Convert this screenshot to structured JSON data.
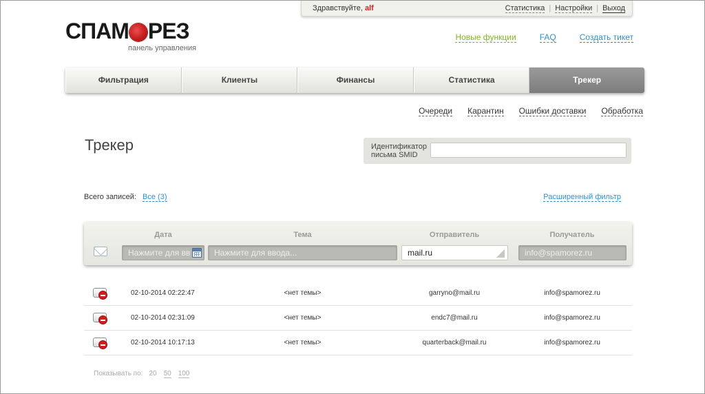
{
  "userbar": {
    "greeting": "Здравствуйте,",
    "username": "alf",
    "links": {
      "stats": "Статистика",
      "settings": "Настройки",
      "logout": "Выход"
    }
  },
  "logo": {
    "left": "СПАМ",
    "right": "РЕЗ",
    "subtitle": "панель управления",
    "brand_color": "#c81d1d"
  },
  "toplinks": {
    "new_features": "Новые функции",
    "faq": "FAQ",
    "create_ticket": "Создать тикет"
  },
  "nav": {
    "tabs": [
      {
        "label": "Фильтрация"
      },
      {
        "label": "Клиенты"
      },
      {
        "label": "Финансы"
      },
      {
        "label": "Статистика"
      },
      {
        "label": "Трекер",
        "active": true
      }
    ]
  },
  "subnav": {
    "items": [
      "Очереди",
      "Карантин",
      "Ошибки доставки",
      "Обработка"
    ]
  },
  "page": {
    "title": "Трекер",
    "smid_label_1": "Идентификатор",
    "smid_label_2": "письма SMID",
    "smid_value": ""
  },
  "summary": {
    "total_label": "Всего записей:",
    "total_link": "Все (3)",
    "advanced_filter": "Расширенный фильтр"
  },
  "filter": {
    "headers": {
      "date": "Дата",
      "subject": "Тема",
      "sender": "Отправитель",
      "recipient": "Получатель"
    },
    "date_placeholder": "Нажмите для вв",
    "subject_placeholder": "Нажмите для ввода...",
    "sender_value": "mail.ru",
    "recipient_placeholder": "info@spamorez.ru"
  },
  "rows": [
    {
      "date": "02-10-2014 02:22:47",
      "subject": "<нет темы>",
      "sender": "garryno@mail.ru",
      "recipient": "info@spamorez.ru"
    },
    {
      "date": "02-10-2014 02:31:09",
      "subject": "<нет темы>",
      "sender": "endc7@mail.ru",
      "recipient": "info@spamorez.ru"
    },
    {
      "date": "02-10-2014 10:17:13",
      "subject": "<нет темы>",
      "sender": "quarterback@mail.ru",
      "recipient": "info@spamorez.ru"
    }
  ],
  "pager": {
    "label": "Показывать по:",
    "sizes": [
      "20",
      "50",
      "100"
    ]
  }
}
